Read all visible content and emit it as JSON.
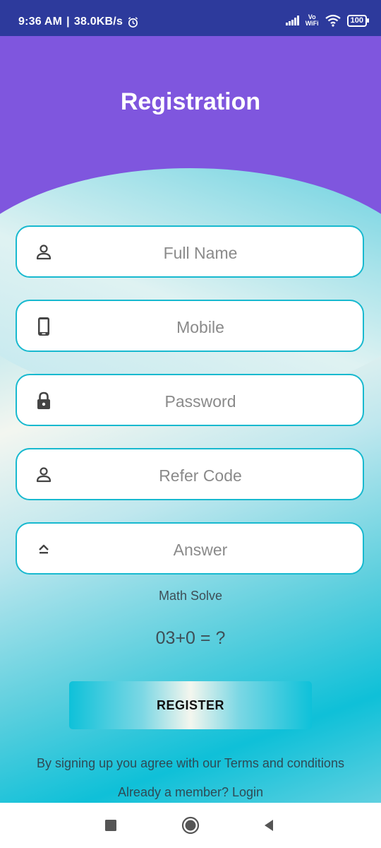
{
  "status_bar": {
    "time": "9:36 AM",
    "separator": "|",
    "speed": "38.0KB/s",
    "vowifi_line1": "Vo",
    "vowifi_line2": "WiFi",
    "battery": "100"
  },
  "header": {
    "title": "Registration"
  },
  "form": {
    "fields": [
      {
        "placeholder": "Full Name",
        "icon": "person-icon",
        "value": ""
      },
      {
        "placeholder": "Mobile",
        "icon": "phone-icon",
        "value": ""
      },
      {
        "placeholder": "Password",
        "icon": "lock-icon",
        "value": ""
      },
      {
        "placeholder": "Refer Code",
        "icon": "person-icon",
        "value": ""
      },
      {
        "placeholder": "Answer",
        "icon": "eject-icon",
        "value": ""
      }
    ],
    "math_label": "Math Solve",
    "math_question": "03+0 = ?",
    "register_label": "REGISTER",
    "terms_text": "By signing up you agree with our Terms and conditions",
    "login_text": "Already a member? Login"
  },
  "colors": {
    "status_bar": "#2d3a9c",
    "header": "#7f56de",
    "field_border": "#18b9cf",
    "accent": "#0ec1d9"
  },
  "navbar": {
    "buttons": [
      "recents-icon",
      "home-icon",
      "back-icon"
    ]
  }
}
